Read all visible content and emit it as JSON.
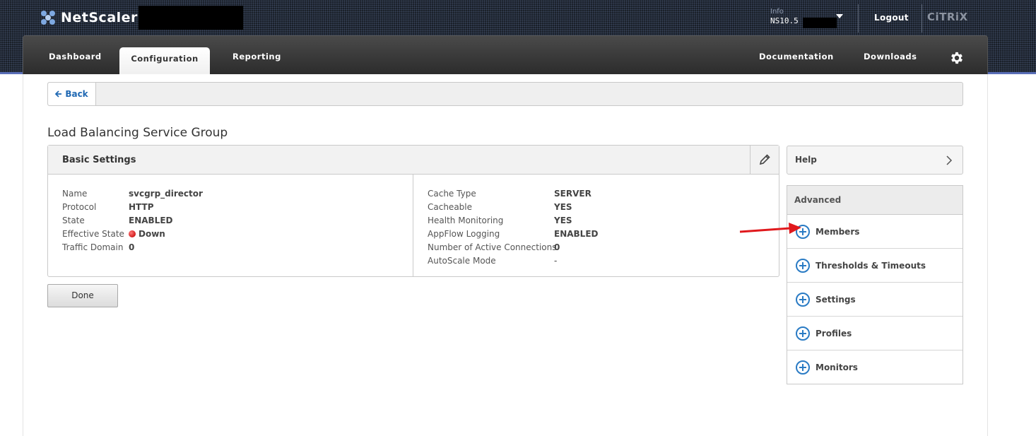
{
  "app": {
    "brand": "NetScaler",
    "info_label": "Info",
    "info_value": "NS10.5",
    "logout": "Logout",
    "vendor": "CiTRiX"
  },
  "nav": {
    "tabs": [
      "Dashboard",
      "Configuration",
      "Reporting"
    ],
    "active_tab": "Configuration",
    "right_links": [
      "Documentation",
      "Downloads"
    ]
  },
  "breadcrumb": {
    "back_label": "Back"
  },
  "page": {
    "title": "Load Balancing Service Group"
  },
  "basic_settings": {
    "title": "Basic Settings",
    "left": [
      {
        "key": "Name",
        "value": "svcgrp_director"
      },
      {
        "key": "Protocol",
        "value": "HTTP"
      },
      {
        "key": "State",
        "value": "ENABLED"
      },
      {
        "key": "Effective State",
        "value": "Down"
      },
      {
        "key": "Traffic Domain",
        "value": "0"
      }
    ],
    "right": [
      {
        "key": "Cache Type",
        "value": "SERVER"
      },
      {
        "key": "Cacheable",
        "value": "YES"
      },
      {
        "key": "Health Monitoring",
        "value": "YES"
      },
      {
        "key": "AppFlow Logging",
        "value": "ENABLED"
      },
      {
        "key": "Number of Active Connections",
        "value": "0"
      },
      {
        "key": "AutoScale Mode",
        "value": "-"
      }
    ]
  },
  "actions": {
    "done_label": "Done"
  },
  "sidebar": {
    "help_label": "Help",
    "advanced_title": "Advanced",
    "items": [
      "Members",
      "Thresholds & Timeouts",
      "Settings",
      "Profiles",
      "Monitors"
    ]
  },
  "colors": {
    "accent": "#2a7bc4",
    "link": "#1f68b3",
    "status_down": "#d21a1a",
    "annotation_arrow": "#e0191d"
  }
}
